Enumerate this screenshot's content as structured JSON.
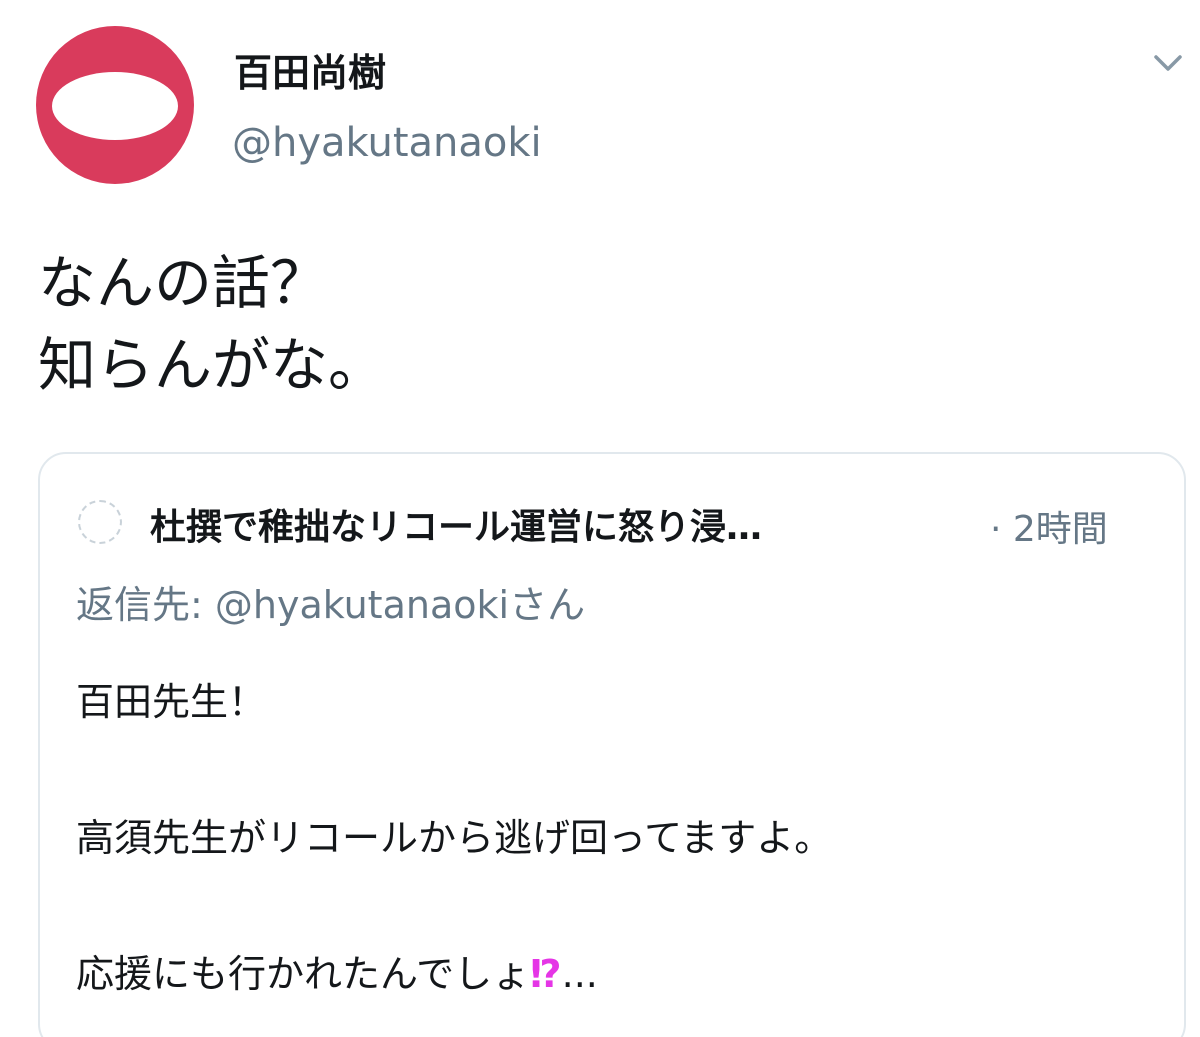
{
  "author": {
    "display_name": "百田尚樹",
    "handle": "@hyakutanaoki",
    "avatar_colors": {
      "ring": "#d93b5c",
      "center": "#ffffff"
    }
  },
  "tweet": {
    "lines": [
      "なんの話？",
      "知らんがな。"
    ]
  },
  "quoted": {
    "author_name": "杜撰で稚拙なリコール運営に怒り浸…",
    "separator": "·",
    "time": "2時間",
    "reply_label": "返信先:",
    "reply_handle": "@hyakutanaoki",
    "reply_suffix": "さん",
    "body": {
      "line1": "百田先生！",
      "line2": "高須先生がリコールから逃げ回ってますよ。",
      "line3": "応援にも行かれたんでしょ",
      "line3_emoji": "⁉",
      "line3_ellipsis": "..."
    }
  },
  "icons": [
    "chevron-down-icon",
    "avatar"
  ],
  "colors": {
    "text_primary": "#14171a",
    "text_secondary": "#657786",
    "border": "#e1e8ed",
    "emoji_accent": "#e535e6"
  }
}
